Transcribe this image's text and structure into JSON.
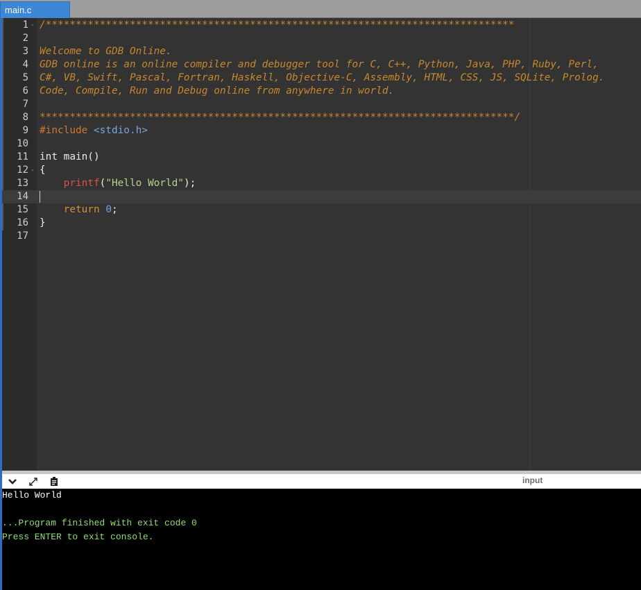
{
  "tab": {
    "label": "main.c"
  },
  "editor": {
    "lines": [
      {
        "n": "1",
        "fold": "-",
        "tokens": [
          {
            "c": "comment",
            "t": "/******************************************************************************"
          }
        ]
      },
      {
        "n": "2",
        "fold": "",
        "tokens": []
      },
      {
        "n": "3",
        "fold": "",
        "tokens": [
          {
            "c": "comment",
            "t": "Welcome to GDB Online."
          }
        ]
      },
      {
        "n": "4",
        "fold": "",
        "tokens": [
          {
            "c": "comment",
            "t": "GDB online is an online compiler and debugger tool for C, C++, Python, Java, PHP, Ruby, Perl,"
          }
        ]
      },
      {
        "n": "5",
        "fold": "",
        "tokens": [
          {
            "c": "comment",
            "t": "C#, VB, Swift, Pascal, Fortran, Haskell, Objective-C, Assembly, HTML, CSS, JS, SQLite, Prolog."
          }
        ]
      },
      {
        "n": "6",
        "fold": "",
        "tokens": [
          {
            "c": "comment",
            "t": "Code, Compile, Run and Debug online from anywhere in world."
          }
        ]
      },
      {
        "n": "7",
        "fold": "",
        "tokens": []
      },
      {
        "n": "8",
        "fold": "",
        "tokens": [
          {
            "c": "comment",
            "t": "*******************************************************************************/"
          }
        ]
      },
      {
        "n": "9",
        "fold": "",
        "tokens": [
          {
            "c": "pre",
            "t": "#include "
          },
          {
            "c": "header",
            "t": "<stdio.h>"
          }
        ]
      },
      {
        "n": "10",
        "fold": "",
        "tokens": []
      },
      {
        "n": "11",
        "fold": "",
        "tokens": [
          {
            "c": "plain",
            "t": "int main()"
          }
        ]
      },
      {
        "n": "12",
        "fold": "-",
        "tokens": [
          {
            "c": "plain",
            "t": "{"
          }
        ]
      },
      {
        "n": "13",
        "fold": "",
        "tokens": [
          {
            "c": "plain",
            "t": "    "
          },
          {
            "c": "func",
            "t": "printf"
          },
          {
            "c": "plain",
            "t": "("
          },
          {
            "c": "str",
            "t": "\"Hello World\""
          },
          {
            "c": "plain",
            "t": ");"
          }
        ]
      },
      {
        "n": "14",
        "fold": "",
        "tokens": [],
        "active": true
      },
      {
        "n": "15",
        "fold": "",
        "tokens": [
          {
            "c": "plain",
            "t": "    "
          },
          {
            "c": "kw",
            "t": "return"
          },
          {
            "c": "plain",
            "t": " "
          },
          {
            "c": "num",
            "t": "0"
          },
          {
            "c": "plain",
            "t": ";"
          }
        ]
      },
      {
        "n": "16",
        "fold": "",
        "tokens": [
          {
            "c": "plain",
            "t": "}"
          }
        ]
      },
      {
        "n": "17",
        "fold": "",
        "tokens": []
      }
    ]
  },
  "console_toolbar": {
    "input_label": "input",
    "buttons": [
      {
        "name": "collapse-console-button",
        "icon": "chevron-down-icon"
      },
      {
        "name": "expand-console-button",
        "icon": "expand-arrows-icon"
      },
      {
        "name": "copy-output-button",
        "icon": "clipboard-icon"
      }
    ]
  },
  "console": {
    "lines": [
      {
        "t": "Hello World",
        "c": "white"
      },
      {
        "t": "",
        "c": "white"
      },
      {
        "t": "...Program finished with exit code 0",
        "c": "green"
      },
      {
        "t": "Press ENTER to exit console.",
        "c": "green"
      }
    ]
  },
  "colors": {
    "tab_active": "#3d87d6",
    "comment": "#c8872e",
    "console_green": "#8fdf6f",
    "editor_bg": "#333333",
    "gutter_bg": "#2b2b2b"
  }
}
